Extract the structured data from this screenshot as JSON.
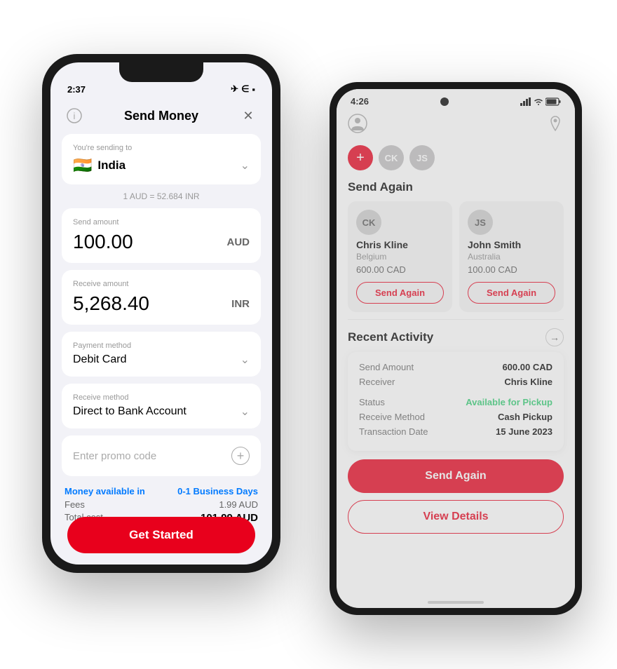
{
  "iphone": {
    "status": {
      "time": "2:37",
      "icons": [
        "plane",
        "wifi",
        "battery"
      ]
    },
    "header": {
      "info_label": "ℹ",
      "title": "Send Money",
      "close_label": "✕"
    },
    "sending_to": {
      "label": "You're sending to",
      "country": "India",
      "flag": "🇮🇳"
    },
    "exchange_rate": "1 AUD = 52.684 INR",
    "send_amount": {
      "label": "Send amount",
      "value": "100.00",
      "currency": "AUD"
    },
    "receive_amount": {
      "label": "Receive amount",
      "value": "5,268.40",
      "currency": "INR"
    },
    "payment_method": {
      "label": "Payment method",
      "value": "Debit Card"
    },
    "receive_method": {
      "label": "Receive method",
      "value": "Direct to Bank Account"
    },
    "promo": {
      "placeholder": "Enter promo code"
    },
    "summary": {
      "availability_label": "Money available in",
      "availability_value": "0-1 Business Days",
      "fees_label": "Fees",
      "fees_value": "1.99 AUD",
      "total_label": "Total cost",
      "total_value": "101.99 AUD"
    },
    "cta": "Get Started"
  },
  "android": {
    "status": {
      "time": "4:26"
    },
    "contacts": [
      {
        "initials": "CK",
        "color": "#b0b0b0"
      },
      {
        "initials": "JS",
        "color": "#b0b0b0"
      }
    ],
    "send_again": {
      "title": "Send Again",
      "recipients": [
        {
          "initials": "CK",
          "name": "Chris Kline",
          "country": "Belgium",
          "amount": "600.00 CAD",
          "btn_label": "Send Again"
        },
        {
          "initials": "JS",
          "name": "John Smith",
          "country": "Australia",
          "amount": "100.00 CAD",
          "btn_label": "Send Again"
        }
      ]
    },
    "recent_activity": {
      "title": "Recent Activity",
      "send_amount_label": "Send Amount",
      "send_amount_value": "600.00 CAD",
      "receiver_label": "Receiver",
      "receiver_value": "Chris Kline",
      "status_label": "Status",
      "status_value": "Available for Pickup",
      "receive_method_label": "Receive Method",
      "receive_method_value": "Cash Pickup",
      "transaction_date_label": "Transaction Date",
      "transaction_date_value": "15 June 2023"
    },
    "cta_send_again": "Send Again",
    "cta_view_details": "View Details"
  }
}
